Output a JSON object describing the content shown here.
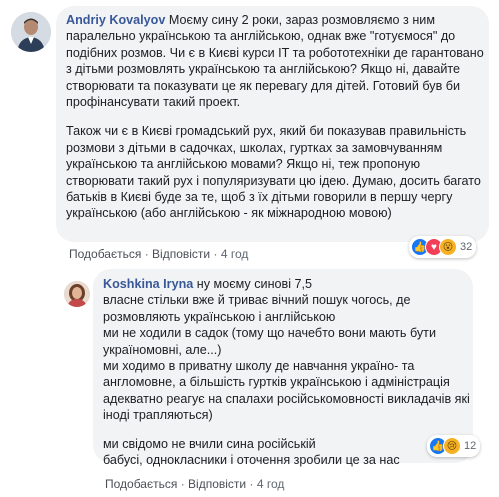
{
  "comment1": {
    "author": "Andriy Kovalyov",
    "text_p1": "Моєму сину 2 роки, зараз розмовляємо з ним паралельно українською та англійською, однак вже \"готуємося\" до подібних розмов. Чи є в Києві курси IT та робототехніки де гарантовано з дітьми розмовлять українською та англійською? Якщо ні, давайте створювати та показувати це як перевагу для дітей. Готовий був би профінансувати такий проект.",
    "text_p2": "Також чи є в Києві громадський рух, який би показував правильність розмови з дітьми в садочках, школах, гуртках за замовчуванням українською та англійською мовами? Якщо ні, теж пропоную створювати такий рух і популяризувати цю ідею. Думаю, досить багато батьків в Києві буде за те, щоб з їх дітьми говорили в першу чергу українською (або англійською - як міжнародною мовою)",
    "actions": {
      "like": "Подобається",
      "reply": "Відповісти",
      "time": "4 год",
      "separator": "·"
    },
    "reactions_count": "32"
  },
  "comment2": {
    "author": "Koshkina Iryna",
    "text_first": "ну моєму синові 7,5",
    "text_p1": "власне стільки вже й триває вічний пошук чогось, де розмовляють українською і англійською\nми не ходили в садок (тому що начебто вони мають бути україномовні, але...)\nми ходимо в приватну школу де навчання україно- та англомовне, а більшість гуртків українською і адміністрація адекватно реагує на спалахи російськомовності викладачів які іноді трапляються)",
    "text_p2": "ми свідомо не вчили сина російській\nбабусі, однокласники і оточення зробили це за нас",
    "actions": {
      "like": "Подобається",
      "reply": "Відповісти",
      "time": "4 год",
      "separator": "·"
    },
    "reactions_count": "12"
  }
}
